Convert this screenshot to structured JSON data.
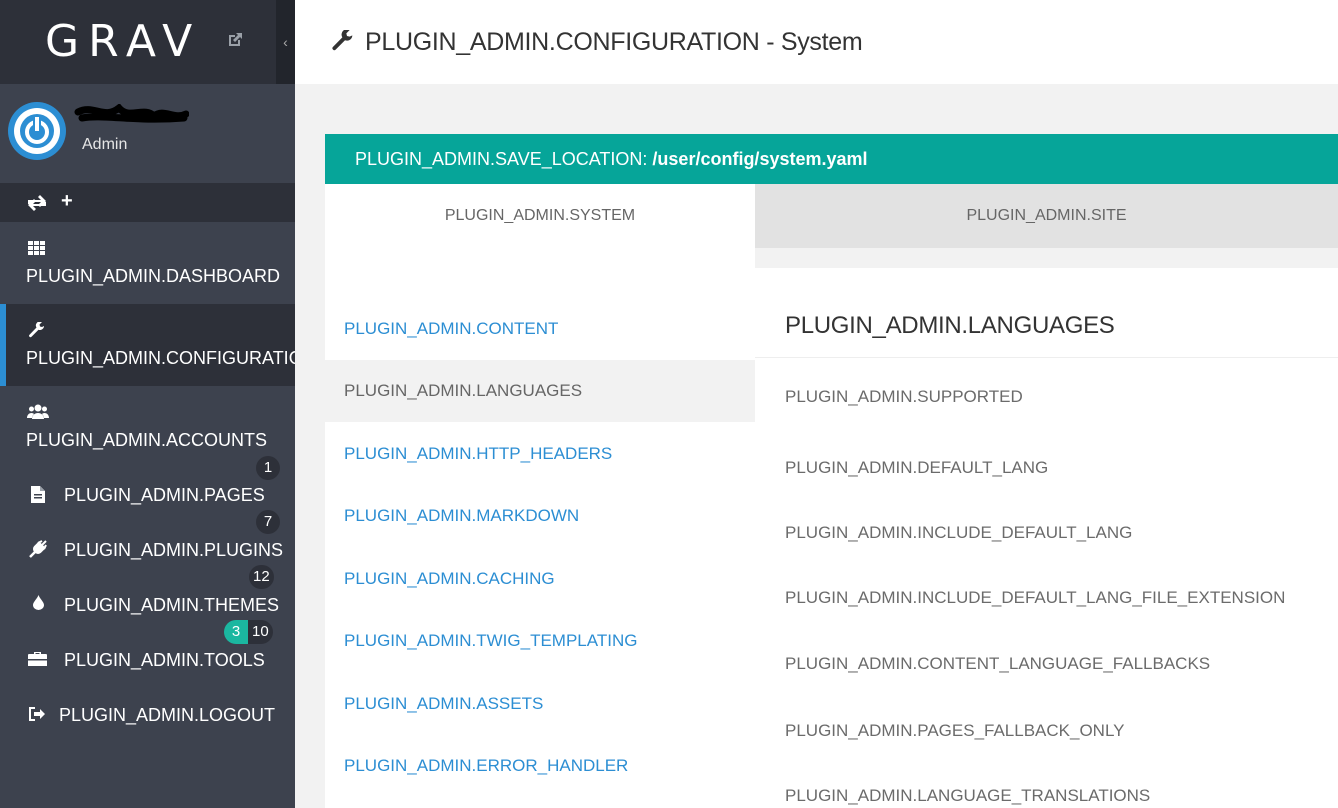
{
  "brand": {
    "logo": "GRAV"
  },
  "user": {
    "role": "Admin"
  },
  "sidebar": {
    "collapse_glyph": "‹",
    "items": [
      {
        "label": "PLUGIN_ADMIN.DASHBOARD",
        "icon": "dashboard-grid-icon"
      },
      {
        "label": "PLUGIN_ADMIN.CONFIGURATION",
        "icon": "wrench-icon",
        "active": true
      },
      {
        "label": "PLUGIN_ADMIN.ACCOUNTS",
        "icon": "users-icon"
      },
      {
        "label": "PLUGIN_ADMIN.PAGES",
        "icon": "file-icon",
        "badge": "1"
      },
      {
        "label": "PLUGIN_ADMIN.PLUGINS",
        "icon": "plug-icon",
        "badge": "7"
      },
      {
        "label": "PLUGIN_ADMIN.THEMES",
        "icon": "droplet-icon",
        "badge": "12"
      },
      {
        "label": "PLUGIN_ADMIN.TOOLS",
        "icon": "briefcase-icon",
        "badge_update": "3",
        "badge": "10"
      },
      {
        "label": "PLUGIN_ADMIN.LOGOUT",
        "icon": "sign-out-icon"
      }
    ]
  },
  "header": {
    "title": "PLUGIN_ADMIN.CONFIGURATION - System"
  },
  "save": {
    "label": "PLUGIN_ADMIN.SAVE_LOCATION:",
    "path": "/user/config/system.yaml"
  },
  "tabs": [
    {
      "label": "PLUGIN_ADMIN.SYSTEM",
      "active": true
    },
    {
      "label": "PLUGIN_ADMIN.SITE",
      "active": false
    }
  ],
  "sections": [
    "PLUGIN_ADMIN.CONTENT",
    "PLUGIN_ADMIN.LANGUAGES",
    "PLUGIN_ADMIN.HTTP_HEADERS",
    "PLUGIN_ADMIN.MARKDOWN",
    "PLUGIN_ADMIN.CACHING",
    "PLUGIN_ADMIN.TWIG_TEMPLATING",
    "PLUGIN_ADMIN.ASSETS",
    "PLUGIN_ADMIN.ERROR_HANDLER"
  ],
  "panel": {
    "heading": "PLUGIN_ADMIN.LANGUAGES",
    "fields": [
      "PLUGIN_ADMIN.SUPPORTED",
      "PLUGIN_ADMIN.DEFAULT_LANG",
      "PLUGIN_ADMIN.INCLUDE_DEFAULT_LANG",
      "PLUGIN_ADMIN.INCLUDE_DEFAULT_LANG_FILE_EXTENSION",
      "PLUGIN_ADMIN.CONTENT_LANGUAGE_FALLBACKS",
      "PLUGIN_ADMIN.PAGES_FALLBACK_ONLY",
      "PLUGIN_ADMIN.LANGUAGE_TRANSLATIONS"
    ]
  },
  "colors": {
    "accent": "#2c8ed3",
    "teal": "#06a599",
    "sidebar": "#3d424e",
    "sidebar_dark": "#2d3039"
  }
}
